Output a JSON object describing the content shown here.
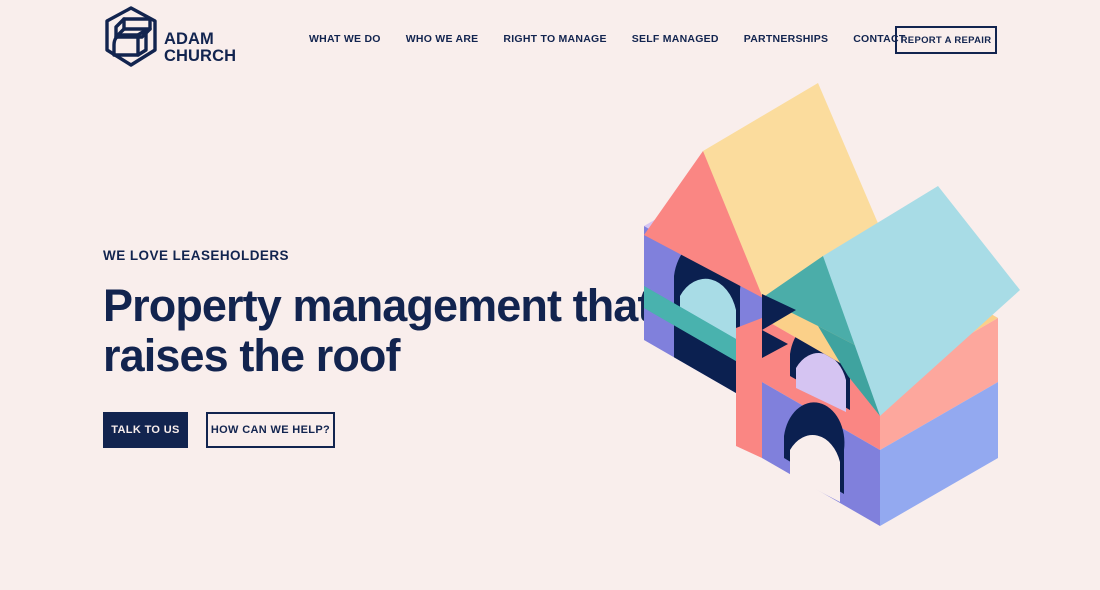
{
  "page": {
    "background_color": "#f9eeec",
    "ink_color": "#12244f"
  },
  "header": {
    "brand": {
      "name": "ADAM\nCHURCH",
      "logo_icon": "adam-church-isometric-mark"
    },
    "nav": [
      {
        "label": "WHAT WE DO"
      },
      {
        "label": "WHO WE ARE"
      },
      {
        "label": "RIGHT TO MANAGE"
      },
      {
        "label": "SELF MANAGED"
      },
      {
        "label": "PARTNERSHIPS"
      },
      {
        "label": "CONTACT"
      }
    ],
    "report_button": {
      "label": "REPORT A REPAIR"
    }
  },
  "hero": {
    "eyebrow": "WE LOVE LEASEHOLDERS",
    "title": "Property management that\nraises the roof",
    "buttons": {
      "primary": "TALK TO US",
      "secondary": "HOW CAN WE HELP?"
    },
    "illustration": {
      "name": "isometric-building-blocks-illustration",
      "colors": {
        "yellow": "#fbdc9d",
        "yellow_dark": "#fbd089",
        "coral": "#fa8683",
        "coral_light": "#fda79d",
        "purple": "#8080dc",
        "lavender": "#d5c4f2",
        "periwinkle": "#93a9f0",
        "teal": "#3fafab",
        "teal_dark": "#4bada9",
        "sky": "#a8dce6",
        "sky_light": "#b5dfe8",
        "navy": "#0b2050"
      }
    }
  }
}
